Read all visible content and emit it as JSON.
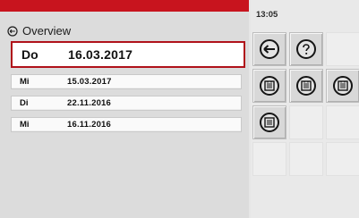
{
  "header": {
    "title": "Overview",
    "icon": "recent-history-icon",
    "accent_color": "#c8141e"
  },
  "list": {
    "rows": [
      {
        "day": "Do",
        "date": "16.03.2017",
        "selected": true
      },
      {
        "day": "Mi",
        "date": "15.03.2017",
        "selected": false
      },
      {
        "day": "Di",
        "date": "22.11.2016",
        "selected": false
      },
      {
        "day": "Mi",
        "date": "16.11.2016",
        "selected": false
      }
    ]
  },
  "status": {
    "time": "13:05"
  },
  "toolbar": {
    "buttons": [
      {
        "icon": "back-arrow-icon"
      },
      {
        "icon": "help-icon"
      },
      {
        "icon": "document-icon"
      },
      {
        "icon": "document-icon"
      },
      {
        "icon": "document-icon"
      },
      {
        "icon": "document-icon"
      }
    ]
  }
}
